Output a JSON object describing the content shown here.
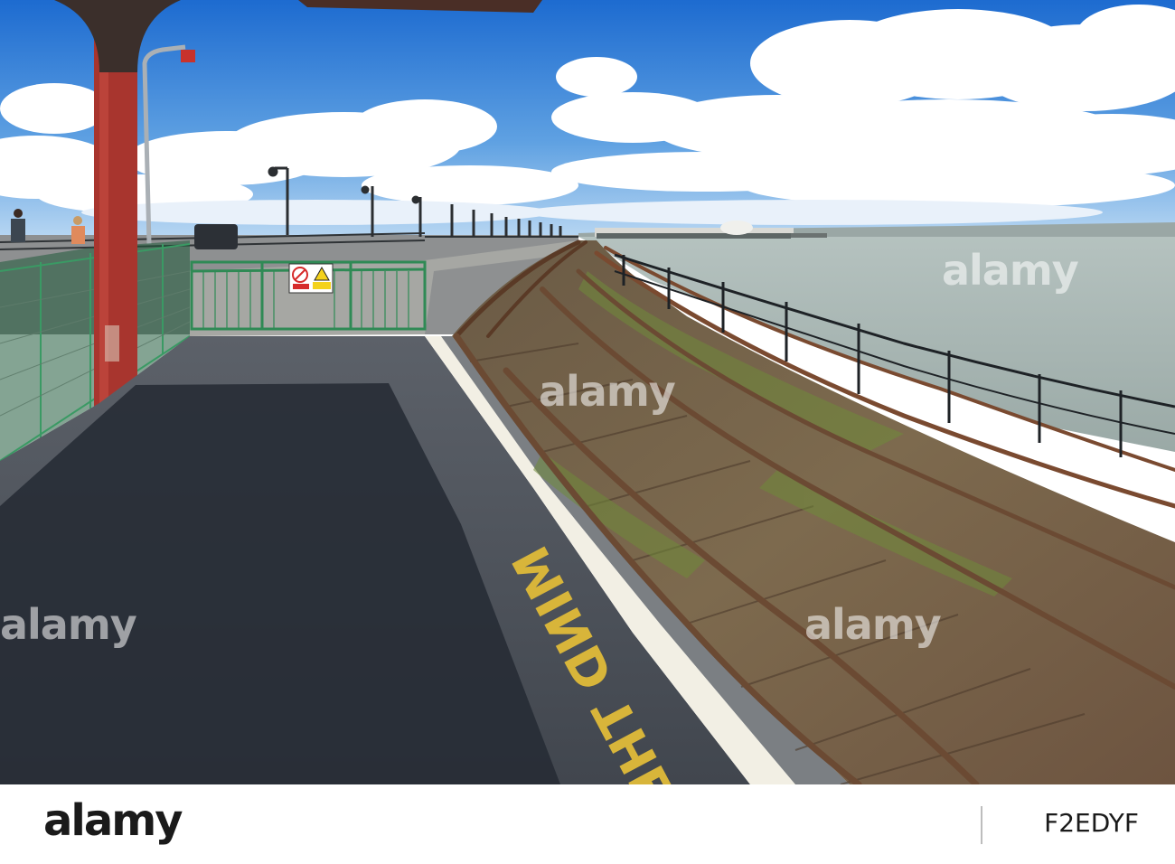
{
  "scene": {
    "platform_marking": "MIND THE G",
    "watermark": "alamy"
  },
  "footer": {
    "logo": "alamy",
    "image_code": "F2EDYF"
  },
  "colors": {
    "sky_top": "#1f6fd1",
    "sky_bottom": "#9cc8ef",
    "sea": "#a9b8b5",
    "platform": "#4a4f57",
    "shadow": "#262b34",
    "edge_line": "#f2efe4",
    "post": "#a8352e",
    "fence_green": "#2f8a55",
    "rail": "#6b4a33",
    "sleepers": "#7a6048",
    "marking": "#d8b53a"
  }
}
